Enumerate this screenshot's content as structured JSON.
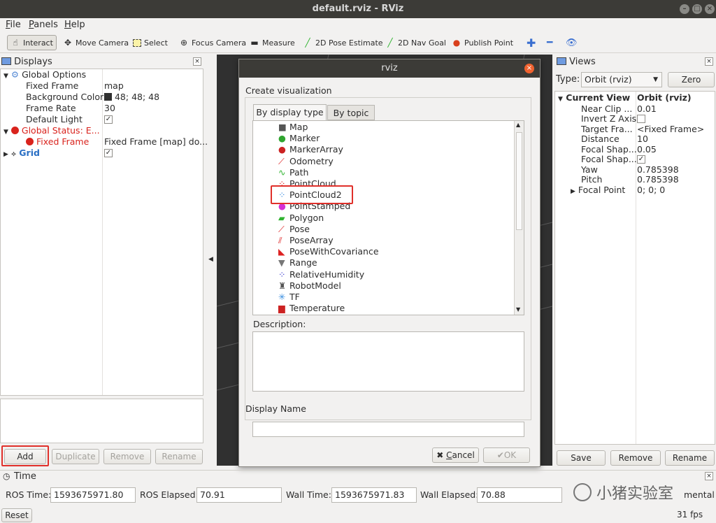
{
  "window": {
    "title": "default.rviz - RViz"
  },
  "menu": [
    {
      "label": "File",
      "key": "F",
      "rest": "ile"
    },
    {
      "label": "Panels",
      "key": "P",
      "rest": "anels"
    },
    {
      "label": "Help",
      "key": "H",
      "rest": "elp"
    }
  ],
  "toolbar": {
    "interact": "Interact",
    "move_camera": "Move Camera",
    "select": "Select",
    "focus_camera": "Focus Camera",
    "measure": "Measure",
    "pose_estimate": "2D Pose Estimate",
    "nav_goal": "2D Nav Goal",
    "publish_point": "Publish Point"
  },
  "displays": {
    "title": "Displays",
    "rows": {
      "global_options": "Global Options",
      "fixed_frame": "Fixed Frame",
      "fixed_frame_value": "map",
      "bg_color": "Background Color",
      "bg_color_value": "48; 48; 48",
      "frame_rate": "Frame Rate",
      "frame_rate_value": "30",
      "default_light": "Default Light",
      "global_status": "Global Status: E...",
      "status_fixed_frame": "Fixed Frame",
      "status_fixed_frame_value": "Fixed Frame [map] do...",
      "grid": "Grid"
    },
    "buttons": {
      "add": "Add",
      "duplicate": "Duplicate",
      "remove": "Remove",
      "rename": "Rename"
    }
  },
  "dialog": {
    "title": "rviz",
    "create_label": "Create visualization",
    "tab_display_type": "By display type",
    "tab_topic": "By topic",
    "items": [
      "Map",
      "Marker",
      "MarkerArray",
      "Odometry",
      "Path",
      "PointCloud",
      "PointCloud2",
      "PointStamped",
      "Polygon",
      "Pose",
      "PoseArray",
      "PoseWithCovariance",
      "Range",
      "RelativeHumidity",
      "RobotModel",
      "TF",
      "Temperature"
    ],
    "description_label": "Description:",
    "display_name_label": "Display Name",
    "display_name_value": "",
    "cancel": "Cancel",
    "cancel_key": "C",
    "cancel_rest": "ancel",
    "ok": "OK"
  },
  "views": {
    "title": "Views",
    "type_label": "Type:",
    "type_value": "Orbit (rviz)",
    "zero": "Zero",
    "current_view": "Current View",
    "current_view_value": "Orbit (rviz)",
    "props": [
      {
        "name": "Near Clip ...",
        "value": "0.01"
      },
      {
        "name": "Invert Z Axis",
        "value": ""
      },
      {
        "name": "Target Fra...",
        "value": "<Fixed Frame>"
      },
      {
        "name": "Distance",
        "value": "10"
      },
      {
        "name": "Focal Shap...",
        "value": "0.05"
      },
      {
        "name": "Focal Shap...",
        "value": ""
      },
      {
        "name": "Yaw",
        "value": "0.785398"
      },
      {
        "name": "Pitch",
        "value": "0.785398"
      },
      {
        "name": "Focal Point",
        "value": "0; 0; 0"
      }
    ],
    "buttons": {
      "save": "Save",
      "remove": "Remove",
      "rename": "Rename"
    }
  },
  "time": {
    "title": "Time",
    "ros_time_label": "ROS Time:",
    "ros_time": "1593675971.80",
    "ros_elapsed_label": "ROS Elapsed:",
    "ros_elapsed": "70.91",
    "wall_time_label": "Wall Time:",
    "wall_time": "1593675971.83",
    "wall_elapsed_label": "Wall Elapsed:",
    "wall_elapsed": "70.88",
    "experimental": "mental",
    "reset": "Reset",
    "fps": "31 fps"
  },
  "watermark": "小猪实验室",
  "colors": {
    "highlight_red": "#e0302a",
    "error_red": "#d9231d",
    "grid_blue": "#2a6fc4",
    "dialog_close": "#f0622f"
  }
}
